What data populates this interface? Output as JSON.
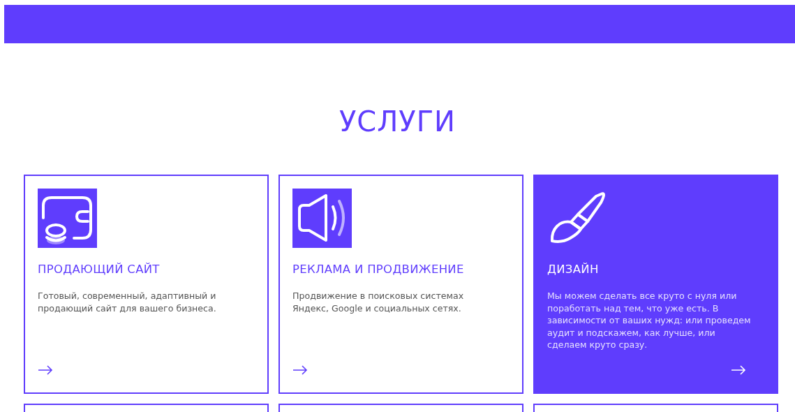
{
  "section_title": "УСЛУГИ",
  "cards": [
    {
      "title": "ПРОДАЮЩИЙ САЙТ",
      "description": "Готовый, современный, адаптивный и продающий сайт для вашего бизнеса.",
      "highlighted": false
    },
    {
      "title": "РЕКЛАМА И ПРОДВИЖЕНИЕ",
      "description": "Продвижение в поисковых системах Яндекс, Google и социальных сетях.",
      "highlighted": false
    },
    {
      "title": "ДИЗАЙН",
      "description": "Мы можем сделать все круто с нуля или поработать над тем, что уже есть. В зависимости от ваших нужд: или проведем аудит и подскажем, как лучше, или сделаем круто сразу.",
      "highlighted": true
    }
  ],
  "partial_cards": [
    {
      "highlighted": false
    },
    {
      "highlighted": false
    },
    {
      "highlighted": false
    }
  ]
}
